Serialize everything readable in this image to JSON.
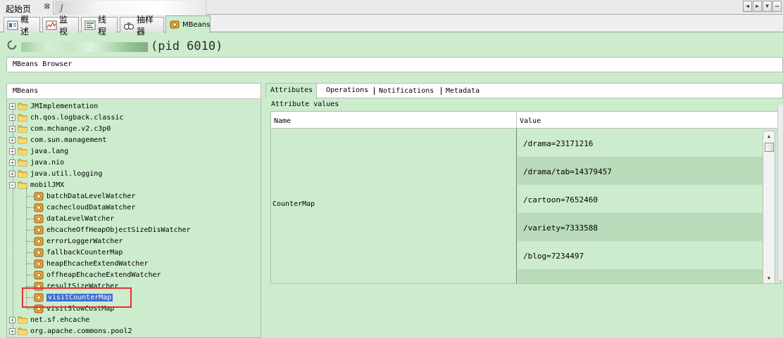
{
  "doc_tabs": {
    "start_page": "起始页",
    "close_glyph": "⊠",
    "second_tab_prefix": "J"
  },
  "view_tabs": [
    {
      "label": "概述",
      "icon": "overview-icon"
    },
    {
      "label": "监视",
      "icon": "monitor-icon"
    },
    {
      "label": "线程",
      "icon": "threads-icon"
    },
    {
      "label": "抽样器",
      "icon": "sampler-icon"
    },
    {
      "label": "MBeans",
      "icon": "mbeans-icon",
      "active": true
    }
  ],
  "header": {
    "pid_text": "(pid 6010)"
  },
  "browser_title": "MBeans Browser",
  "left": {
    "title": "MBeans",
    "tree": [
      {
        "label": "JMImplementation",
        "expanded": false
      },
      {
        "label": "ch.qos.logback.classic",
        "expanded": false
      },
      {
        "label": "com.mchange.v2.c3p0",
        "expanded": false
      },
      {
        "label": "com.sun.management",
        "expanded": false
      },
      {
        "label": "java.lang",
        "expanded": false
      },
      {
        "label": "java.nio",
        "expanded": false
      },
      {
        "label": "java.util.logging",
        "expanded": false
      },
      {
        "label": "mobilJMX",
        "expanded": true,
        "children": [
          "batchDataLevelWatcher",
          "cachecloudDataWatcher",
          "dataLevelWatcher",
          "ehcacheOffHeapObjectSizeDisWatcher",
          "errorLoggerWatcher",
          "fallbackCounterMap",
          "heapEhcacheExtendWatcher",
          "offheapEhcacheExtendWatcher",
          "resultSizeWatcher",
          "visitCounterMap",
          "visitSlowCostMap"
        ]
      },
      {
        "label": "net.sf.ehcache",
        "expanded": false
      },
      {
        "label": "org.apache.commons.pool2",
        "expanded": false
      }
    ],
    "selected": "visitCounterMap"
  },
  "right": {
    "tabs": [
      "Attributes",
      "Operations",
      "Notifications",
      "Metadata"
    ],
    "active_tab": "Attributes",
    "section_label": "Attribute values",
    "columns": {
      "name": "Name",
      "value": "Value"
    },
    "attribute_name": "CounterMap",
    "values": [
      "/drama=23171216",
      "/drama/tab=14379457",
      "/cartoon=7652460",
      "/variety=7333588",
      "/blog=7234497",
      ""
    ]
  },
  "colors": {
    "panel_green": "#cdeccd",
    "row_alt_green": "#b9dbb9",
    "selection_blue": "#3b6fd4",
    "highlight_red": "#e53030"
  }
}
